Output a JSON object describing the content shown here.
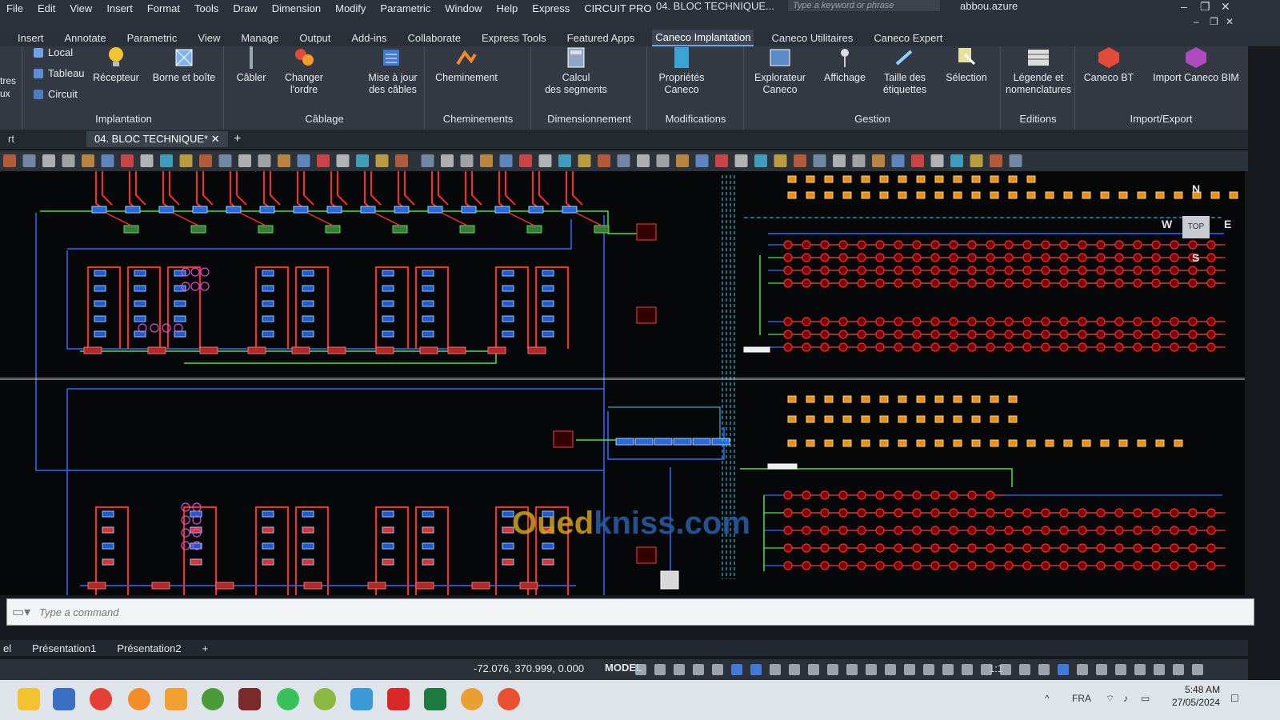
{
  "menus_row1": [
    "File",
    "Edit",
    "View",
    "Insert",
    "Format",
    "Tools",
    "Draw",
    "Dimension",
    "Modify",
    "Parametric",
    "Window",
    "Help",
    "Express",
    "CIRCUIT PRO"
  ],
  "window_title": "04. BLOC TECHNIQUE...",
  "keyword_search_placeholder": "Type a keyword or phrase",
  "user": "abbou.azure",
  "ribbon_tabs": [
    "Insert",
    "Annotate",
    "Parametric",
    "View",
    "Manage",
    "Output",
    "Add-ins",
    "Collaborate",
    "Express Tools",
    "Featured Apps",
    "Caneco Implantation",
    "Caneco Utilitaires",
    "Caneco Expert"
  ],
  "active_ribbon_tab": "Caneco Implantation",
  "ribbon": {
    "cut_left": [
      "tres",
      "ux"
    ],
    "implantation": {
      "items": [
        "Local",
        "Tableau",
        "Circuit"
      ],
      "recepteur": "Récepteur",
      "borne": "Borne et boîte",
      "title": "Implantation"
    },
    "cablage": {
      "cabler": "Câbler",
      "changer": "Changer\nl'ordre",
      "mise": "Mise à jour\ndes câbles",
      "title": "Câblage"
    },
    "cheminements": {
      "label": "Cheminement",
      "title": "Cheminements"
    },
    "dimensionnement": {
      "label": "Calcul\ndes segments",
      "title": "Dimensionnement"
    },
    "modifications": {
      "label": "Propriétés\nCaneco",
      "title": "Modifications"
    },
    "gestion": {
      "items": [
        "Explorateur\nCaneco",
        "Affichage",
        "Taille des\nétiquettes",
        "Sélection"
      ],
      "title": "Gestion"
    },
    "editions": {
      "label": "Légende et\nnomenclatures",
      "title": "Editions"
    },
    "importexport": {
      "bt": "Caneco BT",
      "bim": "Import Caneco BIM",
      "title": "Import/Export"
    }
  },
  "doc_tabs": {
    "prev": "rt",
    "active": "04. BLOC TECHNIQUE*"
  },
  "viewcube": {
    "n": "N",
    "s": "S",
    "e": "E",
    "w": "W",
    "top": "TOP"
  },
  "watermark": {
    "a": "Oued",
    "b": "kniss.com"
  },
  "command_placeholder": "Type a command",
  "layout_tabs": [
    "el",
    "Présentation1",
    "Présentation2",
    "+"
  ],
  "status": {
    "coords": "-72.076, 370.999, 0.000",
    "model": "MODEL",
    "scale": "1:1"
  },
  "tray": {
    "lang": "FRA",
    "time": "5:48 AM",
    "date": "27/05/2024"
  },
  "colors": {
    "red": "#ff2b2b",
    "blue": "#2f6dff",
    "green": "#49e64a",
    "cyan": "#37d6ff",
    "magenta": "#d84fd0",
    "bg": "#070809",
    "accent": "#4a8cff"
  }
}
